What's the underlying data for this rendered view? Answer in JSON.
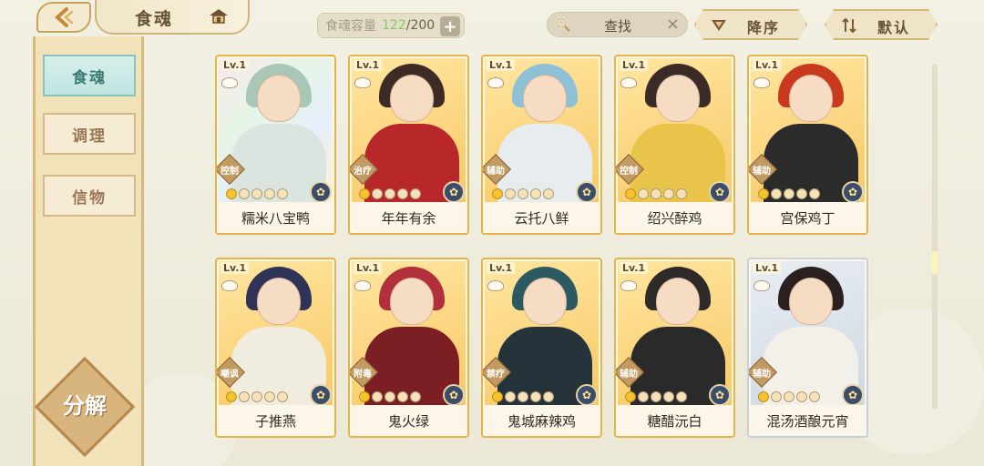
{
  "header": {
    "title": "食魂",
    "capacity_label": "食魂容量",
    "capacity_current": "122",
    "capacity_sep": "/200",
    "plus": "+",
    "search_label": "查找",
    "search_clear": "×",
    "sort_order": "降序",
    "sort_default": "默认"
  },
  "sidebar": {
    "tabs": [
      {
        "label": "食魂",
        "active": true
      },
      {
        "label": "调理",
        "active": false
      },
      {
        "label": "信物",
        "active": false
      }
    ],
    "decompose": "分解"
  },
  "cards": [
    {
      "lv": "Lv.1",
      "name": "糯米八宝鸭",
      "role": "控制",
      "style": "rainbow",
      "hair": "#a8c7b7",
      "body": "#dbe5df"
    },
    {
      "lv": "Lv.1",
      "name": "年年有余",
      "role": "治疗",
      "style": "gold",
      "hair": "#3d2b26",
      "body": "#b8282a"
    },
    {
      "lv": "Lv.1",
      "name": "云托八鲜",
      "role": "辅助",
      "style": "gold",
      "hair": "#8fc1d6",
      "body": "#e7ecef"
    },
    {
      "lv": "Lv.1",
      "name": "绍兴醉鸡",
      "role": "控制",
      "style": "gold",
      "hair": "#3a2b26",
      "body": "#e9c44b"
    },
    {
      "lv": "Lv.1",
      "name": "宫保鸡丁",
      "role": "辅助",
      "style": "gold",
      "hair": "#c8391e",
      "body": "#2b2b2b"
    },
    {
      "lv": "Lv.1",
      "name": "子推燕",
      "role": "嘲讽",
      "style": "gold",
      "hair": "#2f3357",
      "body": "#f1ece0"
    },
    {
      "lv": "Lv.1",
      "name": "鬼火绿",
      "role": "附毒",
      "style": "gold",
      "hair": "#b2303b",
      "body": "#7c1f24"
    },
    {
      "lv": "Lv.1",
      "name": "鬼城麻辣鸡",
      "role": "禁疗",
      "style": "gold",
      "hair": "#2c5a62",
      "body": "#25343a"
    },
    {
      "lv": "Lv.1",
      "name": "糖醋沅白",
      "role": "辅助",
      "style": "gold",
      "hair": "#2d2a28",
      "body": "#2b2a2a"
    },
    {
      "lv": "Lv.1",
      "name": "混汤酒酿元宵",
      "role": "辅助",
      "style": "silver",
      "hair": "#2b2020",
      "body": "#f3f0ea"
    }
  ]
}
